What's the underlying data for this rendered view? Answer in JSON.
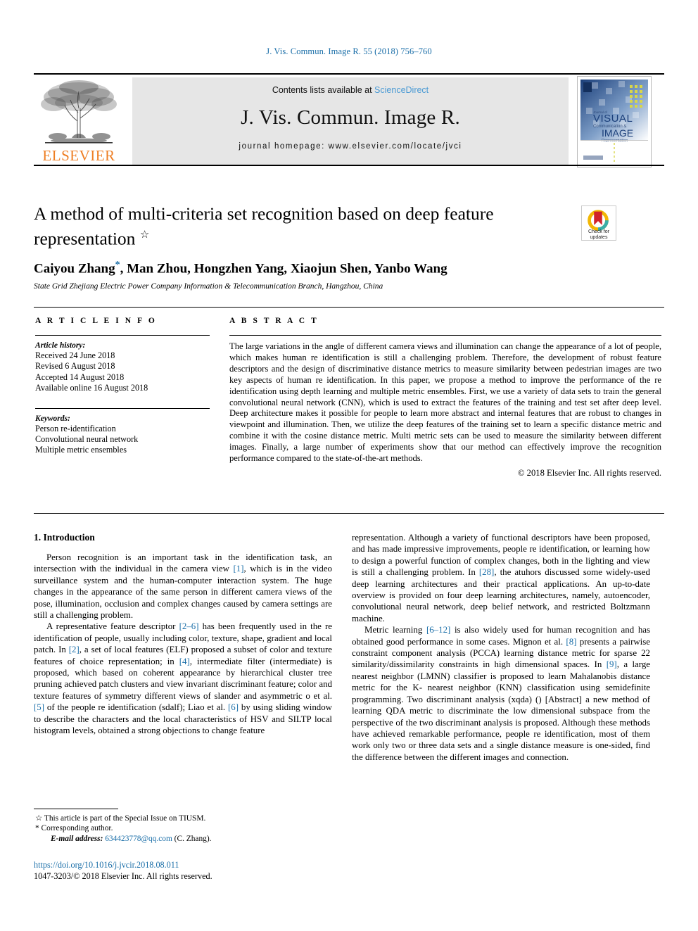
{
  "running_head": "J. Vis. Commun. Image R. 55 (2018) 756–760",
  "masthead": {
    "publisher_name": "ELSEVIER",
    "contents_prefix": "Contents lists available at ",
    "sciencedirect": "ScienceDirect",
    "journal_name": "J. Vis. Commun. Image R.",
    "homepage": "journal homepage: www.elsevier.com/locate/jvci",
    "cover": {
      "kicker": "Journal of",
      "line1": "VISUAL",
      "line2": "Communication &",
      "line3": "IMAGE",
      "line4": "Representation"
    }
  },
  "article": {
    "title": "A method of multi-criteria set recognition based on deep feature representation",
    "title_star": "☆",
    "authors_text": "Caiyou Zhang",
    "authors_rest": ", Man Zhou, Hongzhen Yang, Xiaojun Shen, Yanbo Wang",
    "corresponding_mark": "*",
    "affiliation": "State Grid Zhejiang Electric Power Company Information & Telecommunication Branch, Hangzhou, China"
  },
  "crossmark": {
    "line1": "Check for",
    "line2": "updates"
  },
  "info": {
    "heading": "A R T I C L E   I N F O",
    "history_label": "Article history:",
    "history": [
      "Received 24 June 2018",
      "Revised 6 August 2018",
      "Accepted 14 August 2018",
      "Available online 16 August 2018"
    ],
    "keywords_label": "Keywords:",
    "keywords": [
      "Person re-identification",
      "Convolutional neural network",
      "Multiple metric ensembles"
    ]
  },
  "abstract": {
    "heading": "A B S T R A C T",
    "text": "The large variations in the angle of different camera views and illumination can change the appearance of a lot of people, which makes human re identification is still a challenging problem. Therefore, the development of robust feature descriptors and the design of discriminative distance metrics to measure similarity between pedestrian images are two key aspects of human re identification. In this paper, we propose a method to improve the performance of the re identification using depth learning and multiple metric ensembles. First, we use a variety of data sets to train the general convolutional neural network (CNN), which is used to extract the features of the training and test set after deep level. Deep architecture makes it possible for people to learn more abstract and internal features that are robust to changes in viewpoint and illumination. Then, we utilize the deep features of the training set to learn a specific distance metric and combine it with the cosine distance metric. Multi metric sets can be used to measure the similarity between different images. Finally, a large number of experiments show that our method can effectively improve the recognition performance compared to the state-of-the-art methods.",
    "copyright": "© 2018 Elsevier Inc. All rights reserved."
  },
  "body": {
    "section_heading": "1. Introduction",
    "left_para1_a": "Person recognition is an important task in the identification task, an intersection with the individual in the camera view ",
    "left_para1_ref1": "[1]",
    "left_para1_b": ", which is in the video surveillance system and the human-computer interaction system. The huge changes in the appearance of the same person in different camera views of the pose, illumination, occlusion and complex changes caused by camera settings are still a challenging problem.",
    "left_para2_a": "A representative feature descriptor ",
    "left_para2_ref1": "[2–6]",
    "left_para2_b": " has been frequently used in the re identification of people, usually including color, texture, shape, gradient and local patch. In ",
    "left_para2_ref2": "[2]",
    "left_para2_c": ", a set of local features (ELF) proposed a subset of color and texture features of choice representation; in ",
    "left_para2_ref3": "[4]",
    "left_para2_d": ", intermediate filter (intermediate) is proposed, which based on coherent appearance by hierarchical cluster tree pruning achieved patch clusters and view invariant discriminant feature; color and texture features of symmetry different views of slander and asymmetric o et al. ",
    "left_para2_ref4": "[5]",
    "left_para2_e": " of the people re identification (sdalf); Liao et al. ",
    "left_para2_ref5": "[6]",
    "left_para2_f": " by using sliding window to describe the characters and the local characteristics of HSV and SILTP local histogram levels, obtained a strong objections to change feature",
    "right_para1_a": "representation. Although a variety of functional descriptors have been proposed, and has made impressive improvements, people re identification, or learning how to design a powerful function of complex changes, both in the lighting and view is still a challenging problem. In ",
    "right_para1_ref1": "[28]",
    "right_para1_b": ", the atuhors discussed some widely-used deep learning architectures and their practical applications. An up-to-date overview is provided on four deep learning architectures, namely, autoencoder, convolutional neural network, deep belief network, and restricted Boltzmann machine.",
    "right_para2_a": "Metric learning ",
    "right_para2_ref1": "[6–12]",
    "right_para2_b": " is also widely used for human recognition and has obtained good performance in some cases. Mignon et al. ",
    "right_para2_ref2": "[8]",
    "right_para2_c": " presents a pairwise constraint component analysis (PCCA) learning distance metric for sparse 22 similarity/dissimilarity constraints in high dimensional spaces. In ",
    "right_para2_ref3": "[9]",
    "right_para2_d": ", a large nearest neighbor (LMNN) classifier is proposed to learn Mahalanobis distance metric for the K- nearest neighbor (KNN) classification using semidefinite programming. Two discriminant analysis (xqda) () [Abstract] a new method of learning QDA metric to discriminate the low dimensional subspace from the perspective of the two discriminant analysis is proposed. Although these methods have achieved remarkable performance, people re identification, most of them work only two or three data sets and a single distance measure is one-sided, find the difference between the different images and connection."
  },
  "footnotes": {
    "line1_mark": "☆",
    "line1": " This article is part of the Special Issue on TIUSM.",
    "line2_mark": "*",
    "line2": " Corresponding author.",
    "email_label": "E-mail address:",
    "email": "634423778@qq.com",
    "email_suffix": " (C. Zhang)."
  },
  "doi": {
    "url": "https://doi.org/10.1016/j.jvcir.2018.08.011",
    "issn": "1047-3203/© 2018 Elsevier Inc. All rights reserved."
  },
  "colors": {
    "link_blue": "#1a6ea8",
    "sciencedirect_blue": "#4a9ad4",
    "elsevier_orange": "#ee7e23",
    "banner_gray": "#e6e6e6"
  }
}
